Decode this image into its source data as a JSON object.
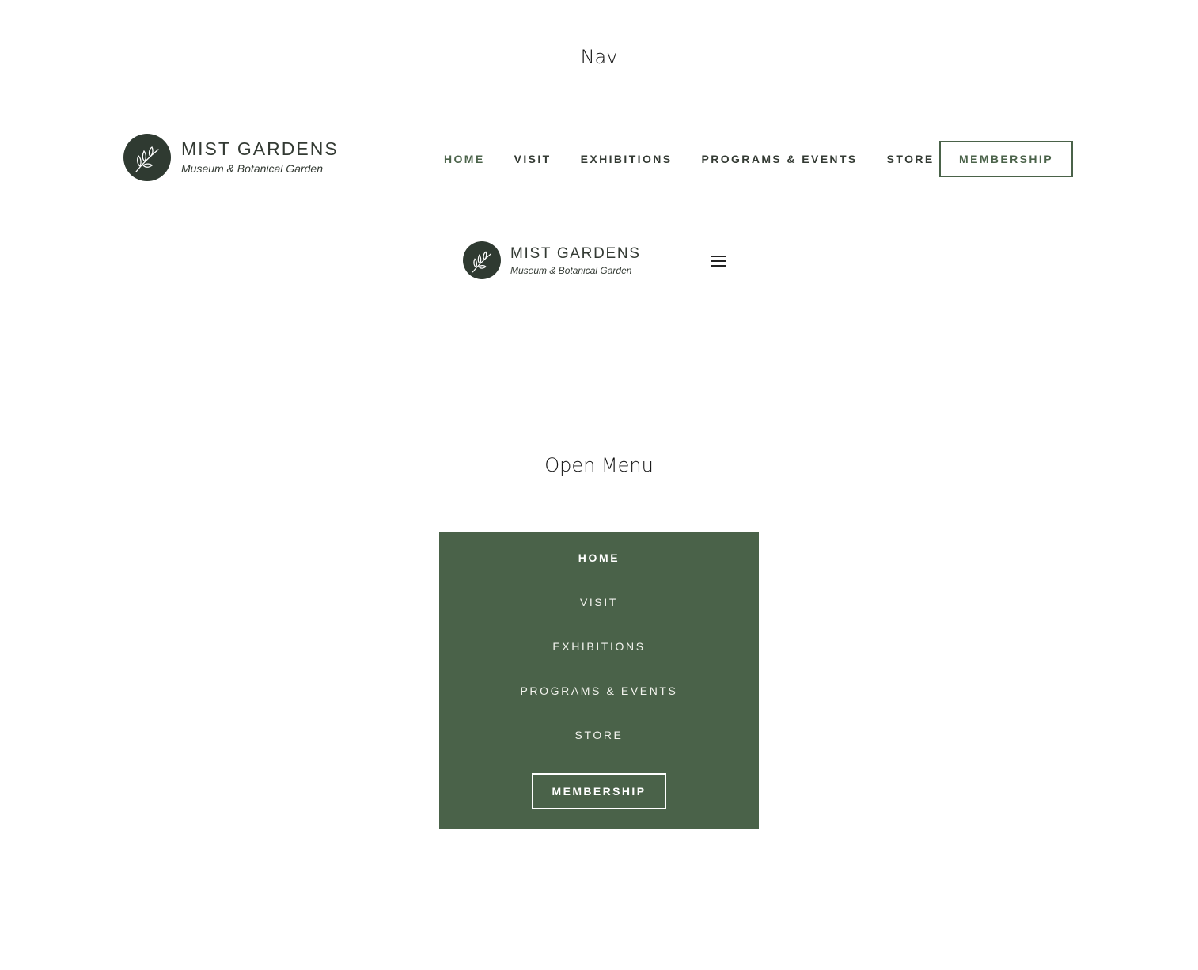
{
  "sections": {
    "nav_title": "Nav",
    "menu_title": "Open Menu"
  },
  "brand": {
    "name": "MIST GARDENS",
    "tagline": "Museum & Botanical Garden",
    "logo_icon": "leaf-branch-icon",
    "logo_color": "#2f3a31"
  },
  "nav": {
    "items": [
      {
        "label": "HOME",
        "active": true
      },
      {
        "label": "VISIT",
        "active": false
      },
      {
        "label": "EXHIBITIONS",
        "active": false
      },
      {
        "label": "PROGRAMS & EVENTS",
        "active": false
      },
      {
        "label": "STORE",
        "active": false
      }
    ],
    "cta_label": "MEMBERSHIP"
  },
  "mobile": {
    "menu_icon": "hamburger-menu-icon"
  },
  "menu": {
    "items": [
      {
        "label": "HOME",
        "active": true
      },
      {
        "label": "VISIT",
        "active": false
      },
      {
        "label": "EXHIBITIONS",
        "active": false
      },
      {
        "label": "PROGRAMS & EVENTS",
        "active": false
      },
      {
        "label": "STORE",
        "active": false
      }
    ],
    "cta_label": "MEMBERSHIP"
  },
  "colors": {
    "accent": "#4a6249",
    "text": "#333a33",
    "menu_text": "#f3f3ee"
  }
}
